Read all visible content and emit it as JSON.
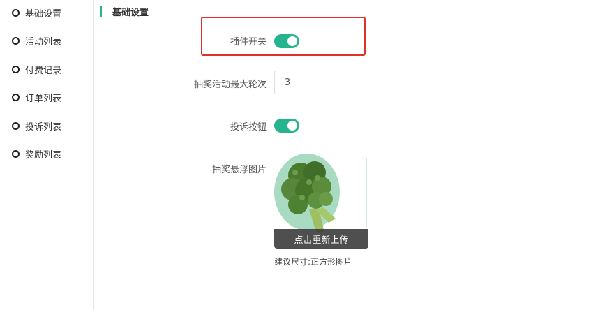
{
  "sidebar": {
    "items": [
      {
        "label": "基础设置"
      },
      {
        "label": "活动列表"
      },
      {
        "label": "付费记录"
      },
      {
        "label": "订单列表"
      },
      {
        "label": "投诉列表"
      },
      {
        "label": "奖励列表"
      }
    ]
  },
  "section": {
    "title": "基础设置"
  },
  "form": {
    "plugin_switch": {
      "label": "插件开关",
      "state": "on"
    },
    "max_rounds": {
      "label": "抽奖活动最大轮次",
      "value": "3"
    },
    "complaint_button": {
      "label": "投诉按钮",
      "state": "on"
    },
    "float_image": {
      "label": "抽奖悬浮图片",
      "reupload_label": "点击重新上传",
      "hint": "建议尺寸:正方形图片"
    }
  },
  "colors": {
    "accent": "#26b48f",
    "highlight": "#e0302a"
  }
}
